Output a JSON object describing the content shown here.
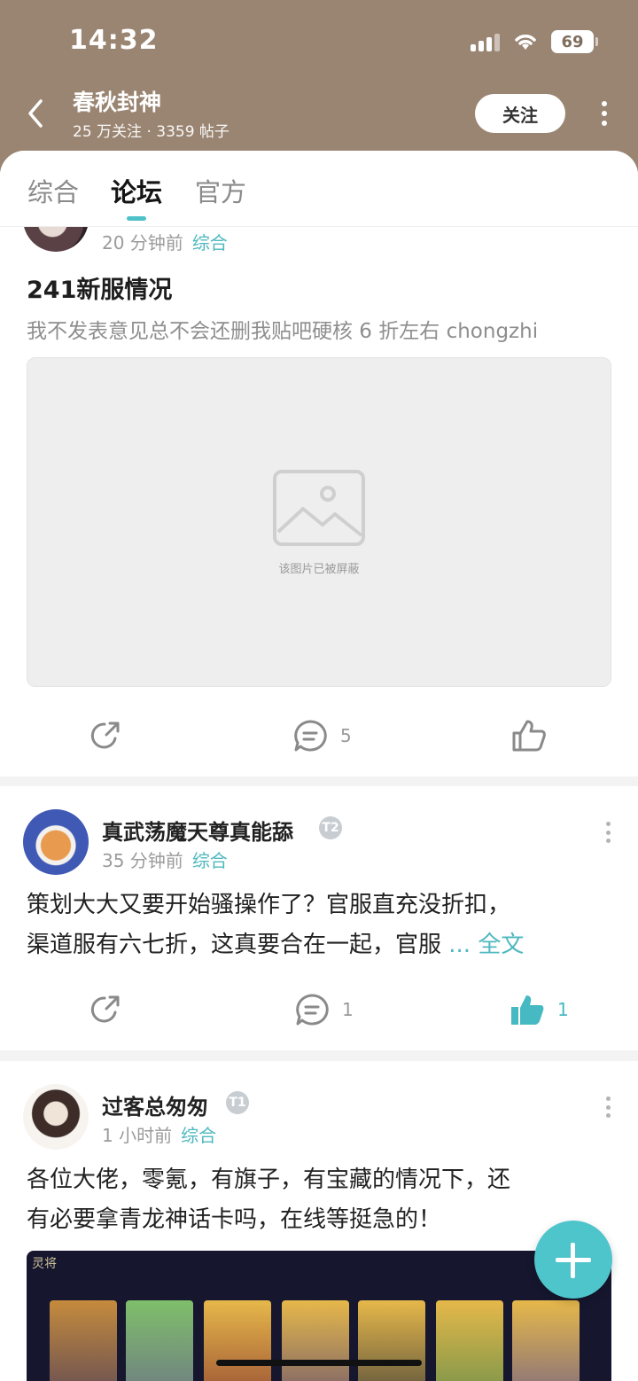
{
  "status": {
    "time": "14:32",
    "battery": "69"
  },
  "header": {
    "title": "春秋封神",
    "meta": "25 万关注 · 3359 帖子",
    "follow_label": "关注"
  },
  "tabs": [
    "综合",
    "论坛",
    "官方"
  ],
  "posts": [
    {
      "time": "20 分钟前",
      "category": "综合",
      "title": "241新服情况",
      "summary": "我不发表意见总不会还删我贴吧硬核 6 折左右 chongzhi",
      "blocked_text": "该图片已被屏蔽",
      "comments": "5"
    },
    {
      "username": "真武荡魔天尊真能舔",
      "level": "T2",
      "time": "35 分钟前",
      "category": "综合",
      "body_line1": "策划大大又要开始骚操作了？官服直充没折扣，",
      "body_line2": "渠道服有六七折，这真要合在一起，官服",
      "fulltext": "... 全文",
      "comments": "1",
      "likes": "1"
    },
    {
      "username": "过客总匆匆",
      "level": "T1",
      "time": "1 小时前",
      "category": "综合",
      "body_line1": "各位大佬，零氪，有旗子，有宝藏的情况下，还",
      "body_line2": "有必要拿青龙神话卡吗，在线等挺急的！",
      "image_label": "灵将"
    }
  ],
  "colors": {
    "header_bg": "#9a8572",
    "accent": "#4fc1c9"
  }
}
